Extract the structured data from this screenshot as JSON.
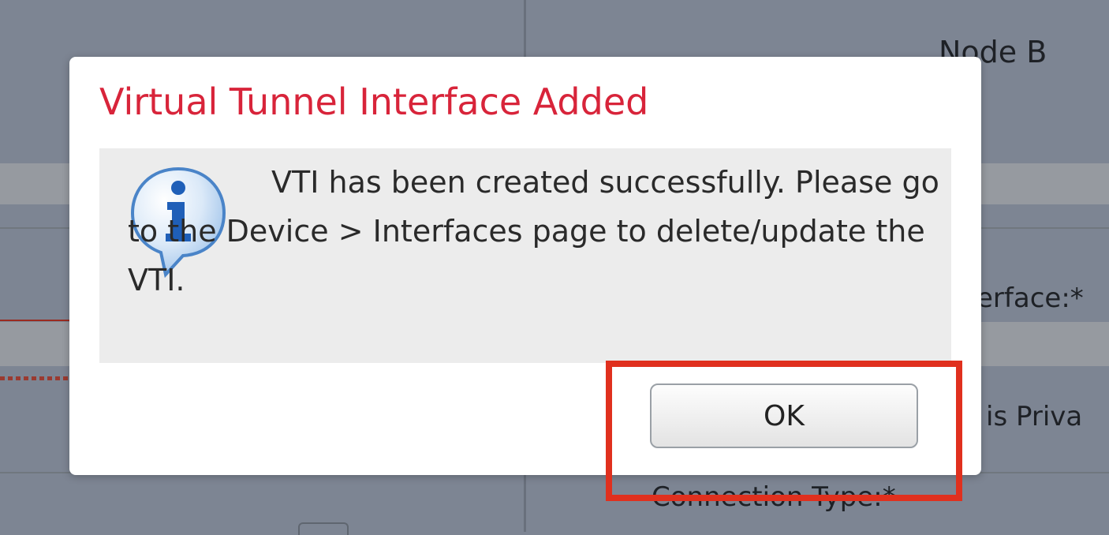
{
  "background": {
    "node_b_label": "Node B",
    "interface_label_fragment": "erface:*",
    "private_label_fragment": "is Priva",
    "connection_type_label": "Connection Type:*"
  },
  "dialog": {
    "title": "Virtual Tunnel Interface Added",
    "icon": "info-speech-bubble-icon",
    "message": "VTI has been created successfully. Please go to the Device > Interfaces page to delete/update the VTI.",
    "ok_label": "OK"
  },
  "colors": {
    "title_red": "#d8243a",
    "highlight_red": "#e0301e",
    "info_blue": "#2d6cc0"
  }
}
